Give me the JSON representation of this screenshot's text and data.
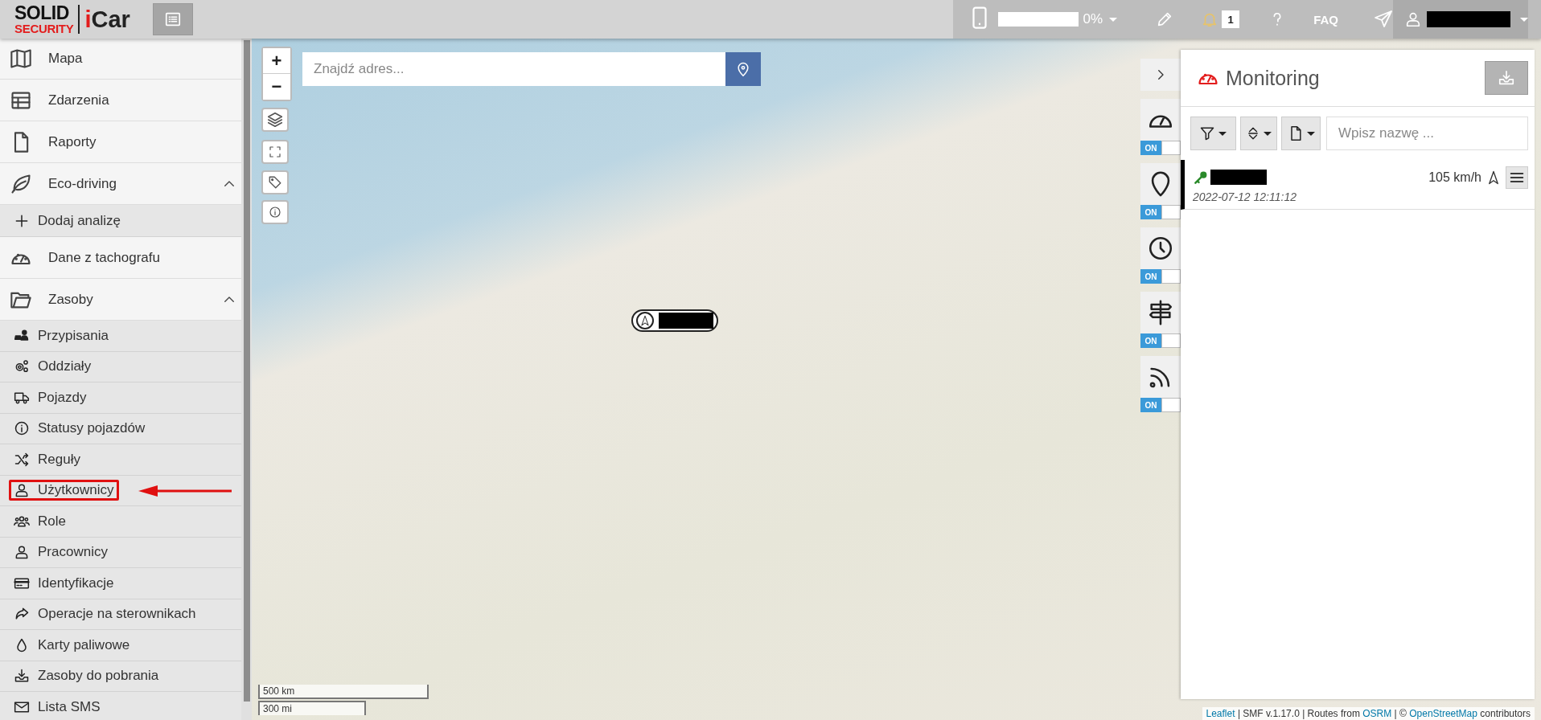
{
  "header": {
    "logo_top": "SOLID",
    "logo_bottom": "SECURITY",
    "app_name": "iCar",
    "battery": {
      "level": 0,
      "reading": "0%"
    },
    "notifications_count": "1",
    "faq": "FAQ"
  },
  "sidebar": {
    "items": [
      {
        "label": "Mapa",
        "expanded": false
      },
      {
        "label": "Zdarzenia",
        "expanded": false
      },
      {
        "label": "Raporty",
        "expanded": false
      },
      {
        "label": "Eco-driving",
        "expanded": true,
        "children": [
          {
            "label": "Dodaj analizę",
            "annotated": false
          }
        ]
      },
      {
        "label": "Dane z tachografu",
        "expanded": false
      },
      {
        "label": "Zasoby",
        "expanded": true,
        "children": [
          {
            "label": "Przypisania",
            "annotated": false
          },
          {
            "label": "Oddziały",
            "annotated": false
          },
          {
            "label": "Pojazdy",
            "annotated": false
          },
          {
            "label": "Statusy pojazdów",
            "annotated": false
          },
          {
            "label": "Reguły",
            "annotated": false
          },
          {
            "label": "Użytkownicy",
            "annotated": true
          },
          {
            "label": "Role",
            "annotated": false
          },
          {
            "label": "Pracownicy",
            "annotated": false
          },
          {
            "label": "Identyfikacje",
            "annotated": false
          },
          {
            "label": "Operacje na sterownikach",
            "annotated": false
          },
          {
            "label": "Karty paliwowe",
            "annotated": false
          },
          {
            "label": "Zasoby do pobrania",
            "annotated": false
          },
          {
            "label": "Lista SMS",
            "annotated": false
          }
        ]
      }
    ]
  },
  "map": {
    "zoom_in": "+",
    "zoom_out": "−",
    "search_placeholder": "Znajdź adres...",
    "scale": [
      "500 km",
      "300 mi"
    ],
    "attribution": [
      {
        "text": "Leaflet",
        "link": true
      },
      {
        "text": " | SMF v.1.17.0 | Routes from ",
        "link": false
      },
      {
        "text": "OSRM",
        "link": true
      },
      {
        "text": " | © ",
        "link": false
      },
      {
        "text": "OpenStreetMap",
        "link": true
      },
      {
        "text": " contributors",
        "link": false
      }
    ]
  },
  "layer_toggles": [
    {
      "label": "ON",
      "on": true
    },
    {
      "label": "ON",
      "on": true
    },
    {
      "label": "ON",
      "on": true
    },
    {
      "label": "ON",
      "on": true
    },
    {
      "label": "ON",
      "on": true
    }
  ],
  "monitoring": {
    "title": "Monitoring",
    "search_placeholder": "Wpisz nazwę ...",
    "vehicles": [
      {
        "timestamp": "2022-07-12 12:11:12",
        "speed": "105 km/h",
        "selected": true,
        "ignition_on": true
      }
    ]
  }
}
